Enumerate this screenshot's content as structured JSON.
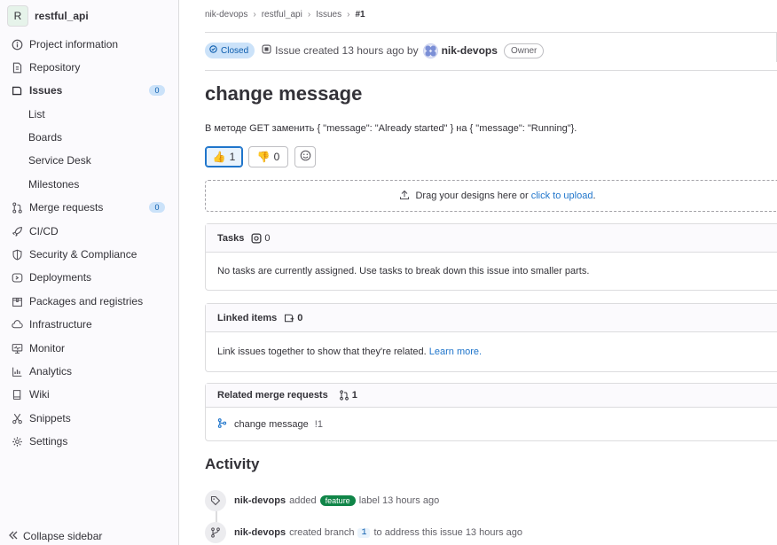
{
  "project": {
    "avatar_letter": "R",
    "name": "restful_api"
  },
  "sidebar": {
    "items": [
      {
        "label": "Project information",
        "icon": "info-icon"
      },
      {
        "label": "Repository",
        "icon": "repository-icon"
      },
      {
        "label": "Issues",
        "icon": "issues-icon",
        "count": "0",
        "active": true
      },
      {
        "label": "List",
        "sub": true
      },
      {
        "label": "Boards",
        "sub": true
      },
      {
        "label": "Service Desk",
        "sub": true
      },
      {
        "label": "Milestones",
        "sub": true
      },
      {
        "label": "Merge requests",
        "icon": "merge-request-icon",
        "count": "0"
      },
      {
        "label": "CI/CD",
        "icon": "rocket-icon"
      },
      {
        "label": "Security & Compliance",
        "icon": "shield-icon"
      },
      {
        "label": "Deployments",
        "icon": "deployments-icon"
      },
      {
        "label": "Packages and registries",
        "icon": "package-icon"
      },
      {
        "label": "Infrastructure",
        "icon": "cloud-icon"
      },
      {
        "label": "Monitor",
        "icon": "monitor-icon"
      },
      {
        "label": "Analytics",
        "icon": "chart-icon"
      },
      {
        "label": "Wiki",
        "icon": "book-icon"
      },
      {
        "label": "Snippets",
        "icon": "scissors-icon"
      },
      {
        "label": "Settings",
        "icon": "gear-icon"
      }
    ],
    "collapse_label": "Collapse sidebar"
  },
  "breadcrumb": [
    "nik-devops",
    "restful_api",
    "Issues",
    "#1"
  ],
  "issue": {
    "status": "Closed",
    "created_text": "Issue created 13 hours ago by",
    "author": "nik-devops",
    "role": "Owner",
    "title": "change message",
    "description": "В методе GET заменить { \"message\": \"Already started\" } на { \"message\": \"Running\"}."
  },
  "reactions": {
    "thumbs_up": "👍",
    "thumbs_up_count": "1",
    "thumbs_down": "👎",
    "thumbs_down_count": "0"
  },
  "dropzone": {
    "text": "Drag your designs here or",
    "link": "click to upload",
    "suffix": "."
  },
  "tasks": {
    "title": "Tasks",
    "count": "0",
    "empty": "No tasks are currently assigned. Use tasks to break down this issue into smaller parts."
  },
  "linked": {
    "title": "Linked items",
    "count": "0",
    "text": "Link issues together to show that they're related.",
    "link": "Learn more."
  },
  "related_mr": {
    "title": "Related merge requests",
    "count": "1",
    "item_title": "change message",
    "item_ref": "!1"
  },
  "activity": {
    "title": "Activity",
    "events": [
      {
        "who": "nik-devops",
        "pre": "added",
        "label": "feature",
        "post": "label 13 hours ago"
      },
      {
        "who": "nik-devops",
        "pre": "created branch",
        "branch": "1",
        "post": "to address this issue 13 hours ago"
      }
    ]
  },
  "colors": {
    "accent": "#1f75cb",
    "closed_badge_bg": "#cbe2f9",
    "feature_label": "#108548"
  }
}
